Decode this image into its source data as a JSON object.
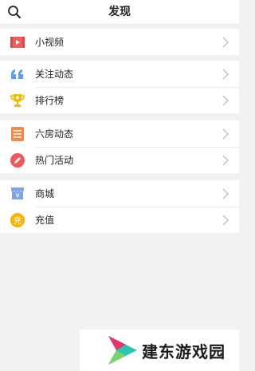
{
  "header": {
    "title": "发现"
  },
  "groups": [
    {
      "items": [
        {
          "label": "小视频",
          "icon": "video-icon",
          "color": "#f25d5d"
        }
      ]
    },
    {
      "items": [
        {
          "label": "关注动态",
          "icon": "quote-icon",
          "color": "#5b9ff5"
        },
        {
          "label": "排行榜",
          "icon": "trophy-icon",
          "color": "#f5b800"
        }
      ]
    },
    {
      "items": [
        {
          "label": "六房动态",
          "icon": "list-icon",
          "color": "#f5894a"
        },
        {
          "label": "热门活动",
          "icon": "pencil-icon",
          "color": "#ee5a5a"
        }
      ]
    },
    {
      "items": [
        {
          "label": "商城",
          "icon": "shop-icon",
          "color": "#7ea4e8",
          "glyph": "¥"
        },
        {
          "label": "充值",
          "icon": "recharge-icon",
          "color": "#f7b500",
          "glyph": "充"
        }
      ]
    }
  ],
  "watermark": {
    "text": "建东游戏园"
  }
}
